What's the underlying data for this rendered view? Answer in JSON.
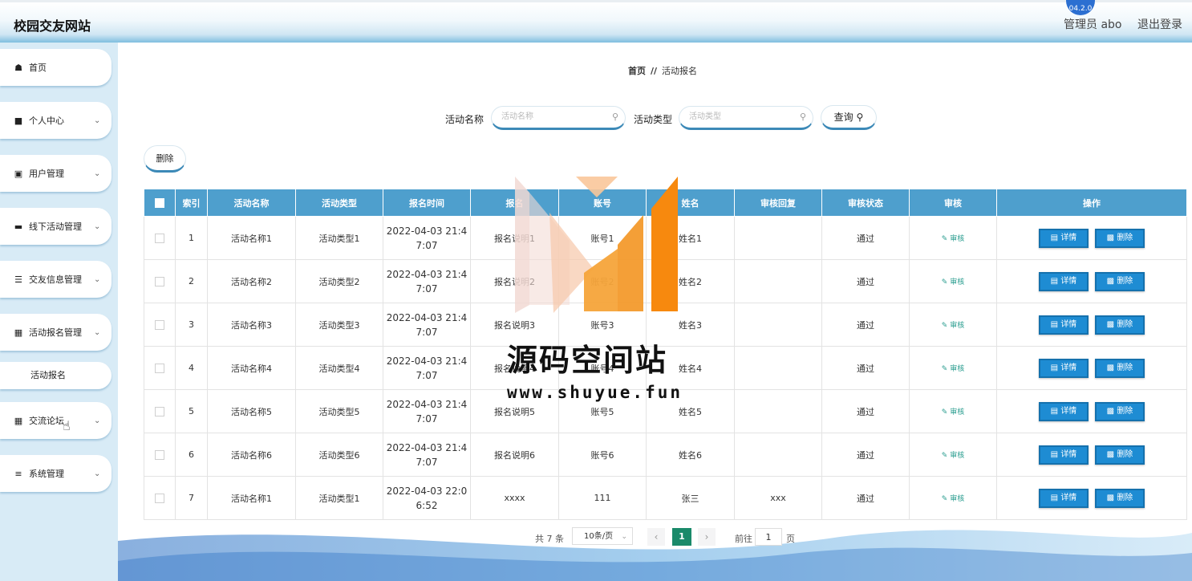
{
  "header": {
    "site_title": "校园交友网站",
    "version_badge": "04.2.0",
    "admin_label": "管理员 abo",
    "logout": "退出登录"
  },
  "sidebar": {
    "items": [
      {
        "label": "首页",
        "icon": "home-icon",
        "expandable": false
      },
      {
        "label": "个人中心",
        "icon": "user-icon",
        "expandable": true
      },
      {
        "label": "用户管理",
        "icon": "clipboard-icon",
        "expandable": true
      },
      {
        "label": "线下活动管理",
        "icon": "briefcase-icon",
        "expandable": true
      },
      {
        "label": "交友信息管理",
        "icon": "list-icon",
        "expandable": true
      },
      {
        "label": "活动报名管理",
        "icon": "grid-icon",
        "expandable": true
      },
      {
        "label": "交流论坛",
        "icon": "grid-icon",
        "expandable": true
      },
      {
        "label": "系统管理",
        "icon": "sliders-icon",
        "expandable": true
      }
    ],
    "sub_item": "活动报名"
  },
  "breadcrumb": {
    "home": "首页",
    "separator": "//",
    "current": "活动报名"
  },
  "search": {
    "name_label": "活动名称",
    "name_placeholder": "活动名称",
    "type_label": "活动类型",
    "type_placeholder": "活动类型",
    "query_button": "查询"
  },
  "actions": {
    "delete_button": "删除"
  },
  "table": {
    "columns": [
      "索引",
      "活动名称",
      "活动类型",
      "报名时间",
      "报名",
      "账号",
      "姓名",
      "审核回复",
      "审核状态",
      "审核",
      "操作"
    ],
    "rows": [
      {
        "index": "1",
        "name": "活动名称1",
        "type": "活动类型1",
        "time1": "2022-04-03 21:4",
        "time2": "7:07",
        "desc": "报名说明1",
        "account": "账号1",
        "person": "姓名1",
        "reply": "",
        "status": "通过"
      },
      {
        "index": "2",
        "name": "活动名称2",
        "type": "活动类型2",
        "time1": "2022-04-03 21:4",
        "time2": "7:07",
        "desc": "报名说明2",
        "account": "账号2",
        "person": "姓名2",
        "reply": "",
        "status": "通过"
      },
      {
        "index": "3",
        "name": "活动名称3",
        "type": "活动类型3",
        "time1": "2022-04-03 21:4",
        "time2": "7:07",
        "desc": "报名说明3",
        "account": "账号3",
        "person": "姓名3",
        "reply": "",
        "status": "通过"
      },
      {
        "index": "4",
        "name": "活动名称4",
        "type": "活动类型4",
        "time1": "2022-04-03 21:4",
        "time2": "7:07",
        "desc": "报名说明4",
        "account": "账号4",
        "person": "姓名4",
        "reply": "",
        "status": "通过"
      },
      {
        "index": "5",
        "name": "活动名称5",
        "type": "活动类型5",
        "time1": "2022-04-03 21:4",
        "time2": "7:07",
        "desc": "报名说明5",
        "account": "账号5",
        "person": "姓名5",
        "reply": "",
        "status": "通过"
      },
      {
        "index": "6",
        "name": "活动名称6",
        "type": "活动类型6",
        "time1": "2022-04-03 21:4",
        "time2": "7:07",
        "desc": "报名说明6",
        "account": "账号6",
        "person": "姓名6",
        "reply": "",
        "status": "通过"
      },
      {
        "index": "7",
        "name": "活动名称1",
        "type": "活动类型1",
        "time1": "2022-04-03 22:0",
        "time2": "6:52",
        "desc": "xxxx",
        "account": "111",
        "person": "张三",
        "reply": "xxx",
        "status": "通过"
      }
    ],
    "audit_link": "审核",
    "detail_button": "详情",
    "row_delete_button": "删除"
  },
  "pagination": {
    "total": "共 7 条",
    "page_size": "10条/页",
    "current_page": "1",
    "goto_label": "前往",
    "goto_value": "1",
    "page_suffix": "页"
  },
  "watermark": {
    "text": "源码空间站",
    "url": "www.shuyue.fun"
  },
  "colors": {
    "accent": "#4e9fcd",
    "button": "#1e8cd3",
    "pager_active": "#1a8a6a",
    "sidebar_bg": "#d8ebf6"
  }
}
